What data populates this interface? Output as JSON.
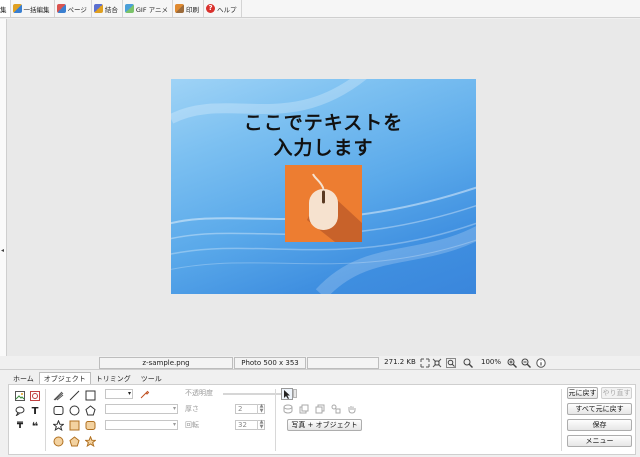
{
  "menu": {
    "items": [
      {
        "label": "集",
        "icon": "cut-tab"
      },
      {
        "label": "一括編集",
        "icon": "batch-edit-icon"
      },
      {
        "label": "ページ",
        "icon": "page-icon"
      },
      {
        "label": "結合",
        "icon": "combine-icon"
      },
      {
        "label": "GIF アニメ",
        "icon": "gif-anime-icon"
      },
      {
        "label": "印刷",
        "icon": "print-icon"
      },
      {
        "label": "ヘルプ",
        "icon": "help-icon"
      }
    ]
  },
  "image": {
    "headline_line1": "ここでテキストを",
    "headline_line2": "入力します",
    "accent_color": "#ed7d31"
  },
  "status": {
    "filename": "z-sample.png",
    "dimensions": "Photo 500 x 353",
    "filesize": "271.2 KB",
    "zoom": "100%"
  },
  "ribbon": {
    "tabs": [
      "ホーム",
      "オブジェクト",
      "トリミング",
      "ツール"
    ],
    "active_tab": "オブジェクト",
    "opacity_label": "不透明度",
    "thickness_label": "厚さ",
    "thickness_value": "2",
    "rotation_label": "回転",
    "rotation_value": "32",
    "photo_object_button": "写真 + オブジェクト",
    "undo": "元に戻す",
    "redo": "やり直す",
    "undo_all": "すべて元に戻す",
    "save": "保存",
    "menu": "メニュー"
  }
}
